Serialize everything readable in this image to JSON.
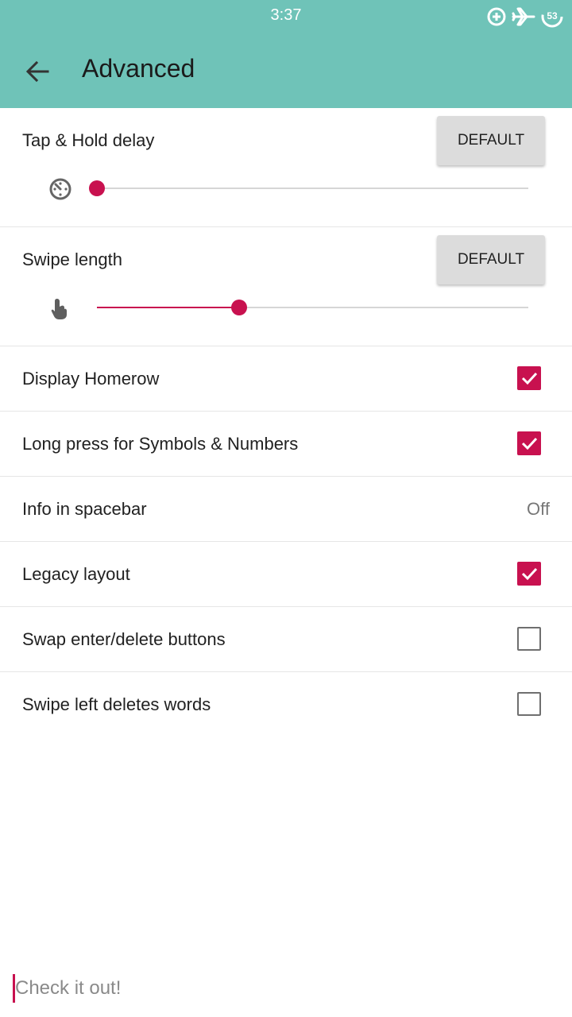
{
  "status_bar": {
    "time": "3:37",
    "battery_level": "53"
  },
  "header": {
    "title": "Advanced",
    "bg_color": "#6fc3b8"
  },
  "accent_color": "#c8114f",
  "sliders": [
    {
      "label": "Tap & Hold delay",
      "button_label": "DEFAULT",
      "icon": "timer-icon",
      "value_fraction": 0.0
    },
    {
      "label": "Swipe length",
      "button_label": "DEFAULT",
      "icon": "swipe-hand-icon",
      "value_fraction": 0.33
    }
  ],
  "settings": [
    {
      "label": "Display Homerow",
      "type": "checkbox",
      "checked": true
    },
    {
      "label": "Long press for Symbols & Numbers",
      "type": "checkbox",
      "checked": true
    },
    {
      "label": "Info in spacebar",
      "type": "value",
      "value": "Off"
    },
    {
      "label": "Legacy layout",
      "type": "checkbox",
      "checked": true
    },
    {
      "label": "Swap enter/delete buttons",
      "type": "checkbox",
      "checked": false
    },
    {
      "label": "Swipe left deletes words",
      "type": "checkbox",
      "checked": false
    }
  ],
  "test_input": {
    "placeholder": "Check it out!"
  }
}
